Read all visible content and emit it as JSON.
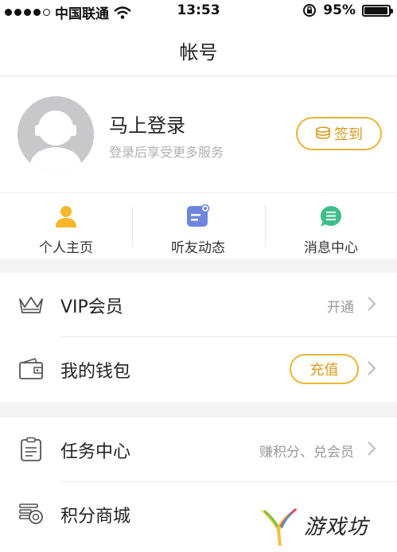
{
  "status_bar": {
    "carrier": "中国联通",
    "time": "13:53",
    "battery_percent": "95%",
    "battery_level": 0.95
  },
  "header": {
    "title": "帐号"
  },
  "profile": {
    "login_title": "马上登录",
    "login_subtitle": "登录后享受更多服务",
    "sign_in_label": "签到"
  },
  "quick_links": [
    {
      "label": "个人主页",
      "icon": "person-icon",
      "color": "#f5b62a"
    },
    {
      "label": "听友动态",
      "icon": "feed-icon",
      "color": "#6c86e0"
    },
    {
      "label": "消息中心",
      "icon": "message-icon",
      "color": "#3dbf8a"
    }
  ],
  "menu": {
    "vip": {
      "label": "VIP会员",
      "right_text": "开通",
      "icon": "crown-icon"
    },
    "wallet": {
      "label": "我的钱包",
      "button_label": "充值",
      "icon": "wallet-icon"
    },
    "tasks": {
      "label": "任务中心",
      "right_text": "赚积分、兑会员",
      "icon": "clipboard-icon"
    },
    "points_mall": {
      "label": "积分商城",
      "icon": "coins-icon"
    }
  },
  "watermark": {
    "text": "游戏坊"
  },
  "colors": {
    "accent": "#e8b636",
    "accent_text": "#d89a1c",
    "divider_band": "#f3f3f3"
  }
}
